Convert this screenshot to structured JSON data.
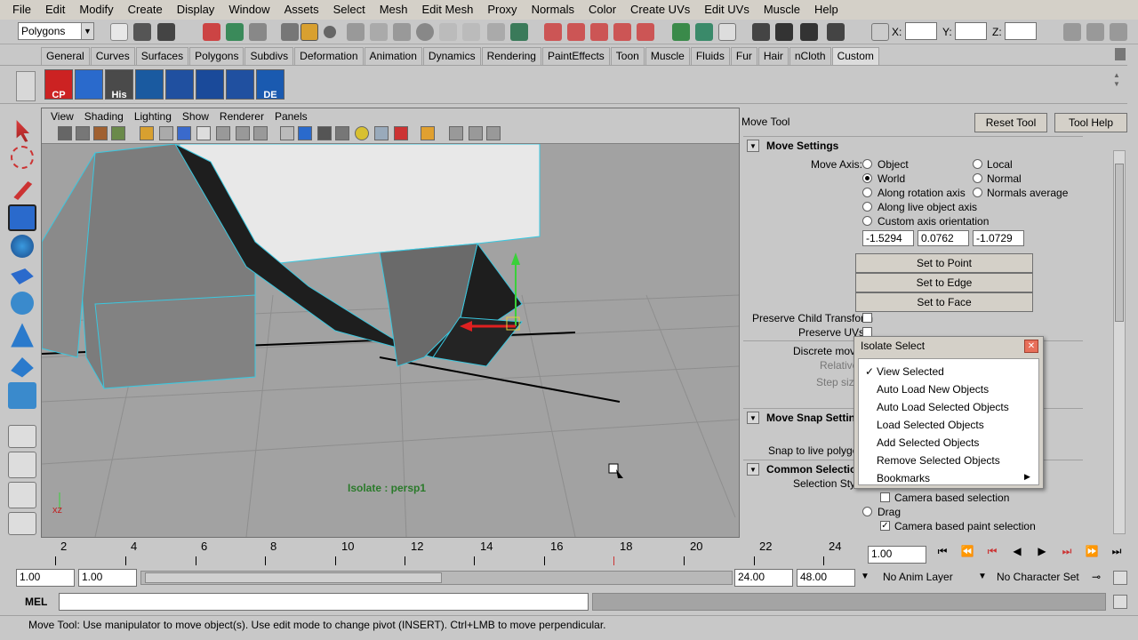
{
  "menu": [
    "File",
    "Edit",
    "Modify",
    "Create",
    "Display",
    "Window",
    "Assets",
    "Select",
    "Mesh",
    "Edit Mesh",
    "Proxy",
    "Normals",
    "Color",
    "Create UVs",
    "Edit UVs",
    "Muscle",
    "Help"
  ],
  "status": {
    "mode": "Polygons",
    "x_label": "X:",
    "y_label": "Y:",
    "z_label": "Z:"
  },
  "shelf_tabs": [
    "General",
    "Curves",
    "Surfaces",
    "Polygons",
    "Subdivs",
    "Deformation",
    "Animation",
    "Dynamics",
    "Rendering",
    "PaintEffects",
    "Toon",
    "Muscle",
    "Fluids",
    "Fur",
    "Hair",
    "nCloth",
    "Custom"
  ],
  "shelf_icons": [
    "CP",
    "",
    "His",
    "",
    "",
    "",
    "",
    "DE"
  ],
  "viewport": {
    "menu": [
      "View",
      "Shading",
      "Lighting",
      "Show",
      "Renderer",
      "Panels"
    ],
    "label": "Isolate : persp1",
    "axis_label": "xz"
  },
  "tool_settings": {
    "title": "Move Tool",
    "reset": "Reset Tool",
    "help": "Tool Help",
    "move_settings": "Move Settings",
    "move_axis_label": "Move Axis:",
    "axis_options": [
      "Object",
      "Local",
      "World",
      "Normal",
      "Along rotation axis",
      "Normals average",
      "Along live object axis",
      "Custom axis orientation"
    ],
    "coords": [
      "-1.5294",
      "0.0762",
      "-1.0729"
    ],
    "set_point": "Set to Point",
    "set_edge": "Set to Edge",
    "set_face": "Set to Face",
    "preserve_child": "Preserve Child Transform",
    "preserve_uvs": "Preserve UVs",
    "discrete_move": "Discrete move",
    "relative": "Relative",
    "step_size": "Step size",
    "snap_settings": "Move Snap Settin",
    "snap_live": "Snap to live polygon",
    "common_selection": "Common Selection",
    "selection_style": "Selection Style",
    "camera_based": "Camera based selection",
    "drag": "Drag",
    "camera_paint": "Camera based paint selection"
  },
  "isolate_popup": {
    "title": "Isolate Select",
    "items": [
      "View Selected",
      "Auto Load New Objects",
      "Auto Load Selected Objects",
      "Load Selected Objects",
      "Add Selected Objects",
      "Remove Selected Objects",
      "Bookmarks"
    ],
    "checked": "View Selected"
  },
  "timeline": {
    "ticks": [
      "2",
      "4",
      "6",
      "8",
      "10",
      "12",
      "14",
      "16",
      "18",
      "20",
      "22",
      "24"
    ],
    "current": "1.00"
  },
  "range": {
    "start": "1.00",
    "inner_start": "1.00",
    "inner_end": "24.00",
    "end": "48.00",
    "anim_layer": "No Anim Layer",
    "char_set": "No Character Set"
  },
  "command": {
    "lang": "MEL"
  },
  "help_text": "Move Tool: Use manipulator to move object(s). Use edit mode to change pivot (INSERT).  Ctrl+LMB to move perpendicular."
}
